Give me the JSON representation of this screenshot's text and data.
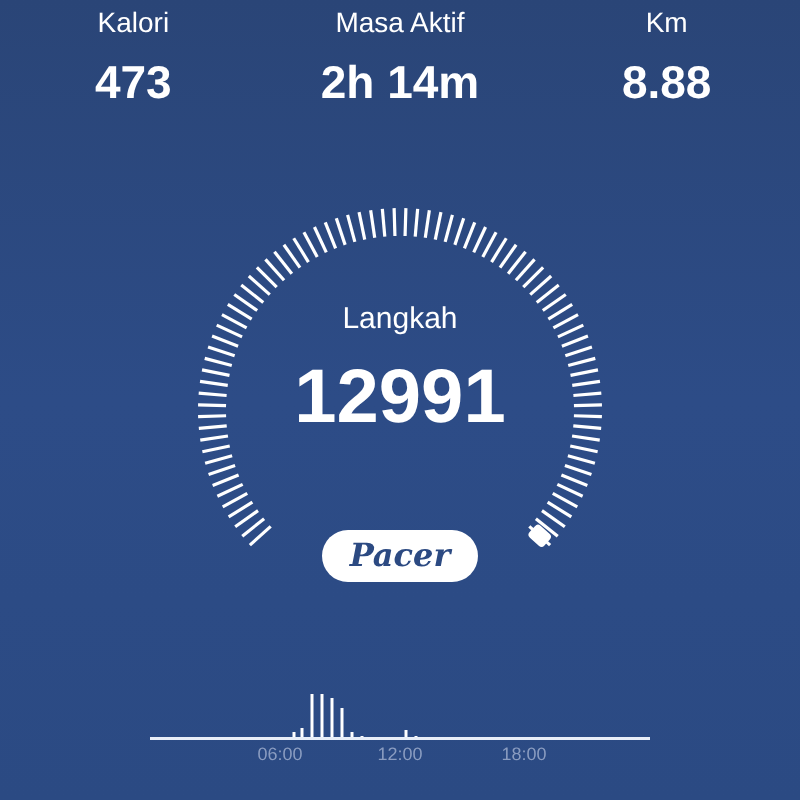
{
  "stats": [
    {
      "label": "Kalori",
      "value": "473"
    },
    {
      "label": "Masa Aktif",
      "value": "2h 14m"
    },
    {
      "label": "Km",
      "value": "8.88"
    }
  ],
  "gauge": {
    "label": "Langkah",
    "value": "12991"
  },
  "logo_text": "Pacer",
  "activity_chart": {
    "time_labels": [
      "06:00",
      "12:00",
      "18:00"
    ]
  }
}
